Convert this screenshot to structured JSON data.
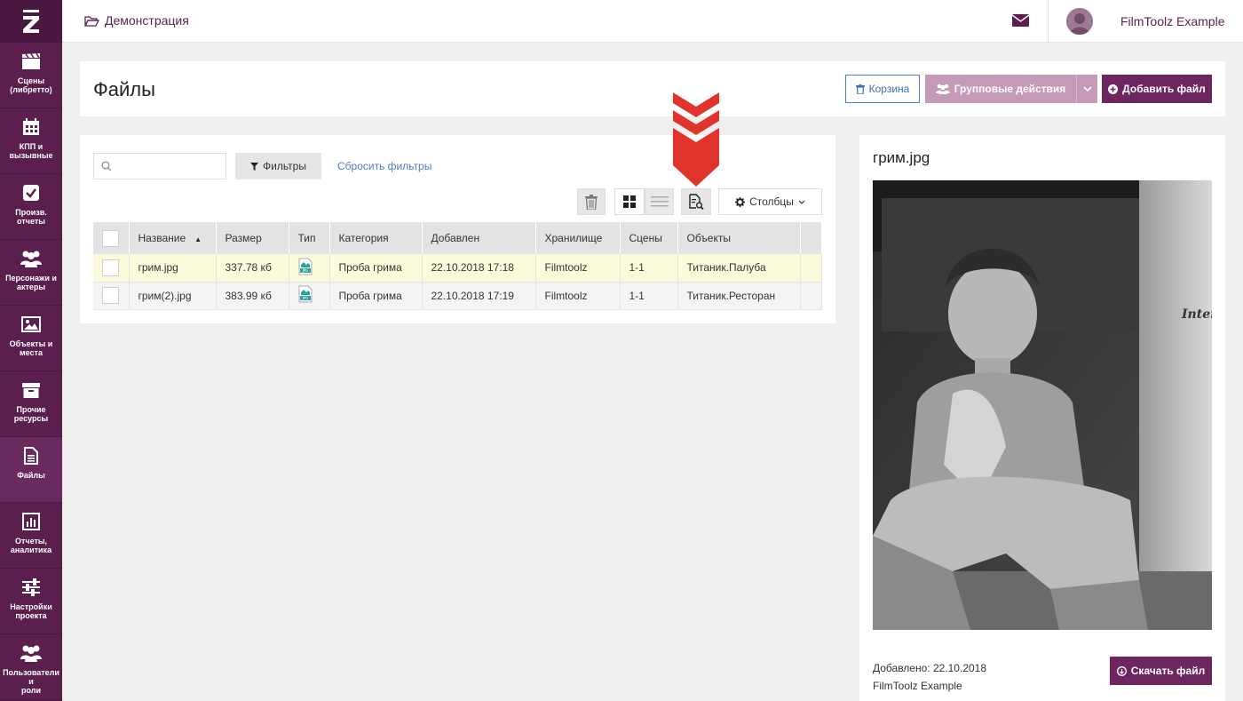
{
  "topbar": {
    "breadcrumb": "Демонстрация",
    "username": "FilmToolz Example"
  },
  "sidebar": {
    "items": [
      {
        "label": "Сцены\n(либретто)"
      },
      {
        "label": "КПП и\nвызывные"
      },
      {
        "label": "Произв.\nотчеты"
      },
      {
        "label": "Персонажи и\nактеры"
      },
      {
        "label": "Объекты и\nместа"
      },
      {
        "label": "Прочие\nресурсы"
      },
      {
        "label": "Файлы"
      },
      {
        "label": "Отчеты,\nаналитика"
      },
      {
        "label": "Настройки\nпроекта"
      },
      {
        "label": "Пользователи и\nроли"
      }
    ]
  },
  "header": {
    "title": "Файлы",
    "trash_label": "Корзина",
    "group_actions_label": "Групповые действия",
    "add_file_label": "Добавить файл"
  },
  "toolbar": {
    "search_placeholder": "",
    "filters_label": "Фильтры",
    "reset_filters_label": "Сбросить фильтры",
    "columns_label": "Столбцы"
  },
  "table": {
    "columns": [
      "Название",
      "Размер",
      "Тип",
      "Категория",
      "Добавлен",
      "Хранилище",
      "Сцены",
      "Объекты"
    ],
    "rows": [
      {
        "name": "грим.jpg",
        "size": "337.78 кб",
        "type": "jpg",
        "category": "Проба грима",
        "added": "22.10.2018 17:18",
        "storage": "Filmtoolz",
        "scenes": "1-1",
        "objects": "Титаник.Палуба"
      },
      {
        "name": "грим(2).jpg",
        "size": "383.99 кб",
        "type": "jpg",
        "category": "Проба грима",
        "added": "22.10.2018 17:19",
        "storage": "Filmtoolz",
        "scenes": "1-1",
        "objects": "Титаник.Ресторан"
      }
    ]
  },
  "preview": {
    "title": "грим.jpg",
    "added_text": "Добавлено: 22.10.2018",
    "author": "FilmToolz Example",
    "download_label": "Скачать файл",
    "photo_text": "Inter"
  },
  "colors": {
    "brand": "#5a1f4f",
    "accent_button": "#6d2660",
    "link": "#4a7ec6",
    "marker": "#e0332b"
  }
}
